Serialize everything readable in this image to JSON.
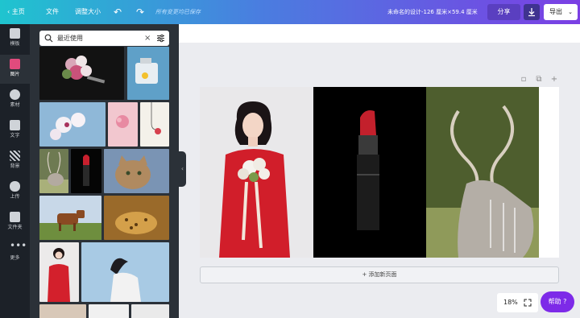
{
  "topbar": {
    "home": "主页",
    "file": "文件",
    "resize": "调整大小",
    "undo_icon": "undo-icon",
    "redo_icon": "redo-icon",
    "saved_status": "所有变更均已保存",
    "design_title": "未命名的设计-126 厘米×59.4 厘米",
    "share": "分享",
    "export": "导出"
  },
  "rail": {
    "items": [
      {
        "label": "模板",
        "icon": "template-icon"
      },
      {
        "label": "图片",
        "icon": "photo-icon"
      },
      {
        "label": "素材",
        "icon": "elements-icon"
      },
      {
        "label": "文字",
        "icon": "text-icon"
      },
      {
        "label": "背景",
        "icon": "background-icon"
      },
      {
        "label": "上传",
        "icon": "upload-icon"
      },
      {
        "label": "文件夹",
        "icon": "folder-icon"
      },
      {
        "label": "更多",
        "icon": "more-icon"
      }
    ]
  },
  "panel": {
    "search_value": "最近使用"
  },
  "canvas": {
    "add_page": "+ 添加新页面"
  },
  "footer": {
    "zoom": "18%",
    "help": "帮助 ?"
  },
  "colors": {
    "accent": "#7d2ae8",
    "dark_panel": "#2b3138",
    "rail": "#1c2128",
    "active_icon": "#e14b7d"
  }
}
